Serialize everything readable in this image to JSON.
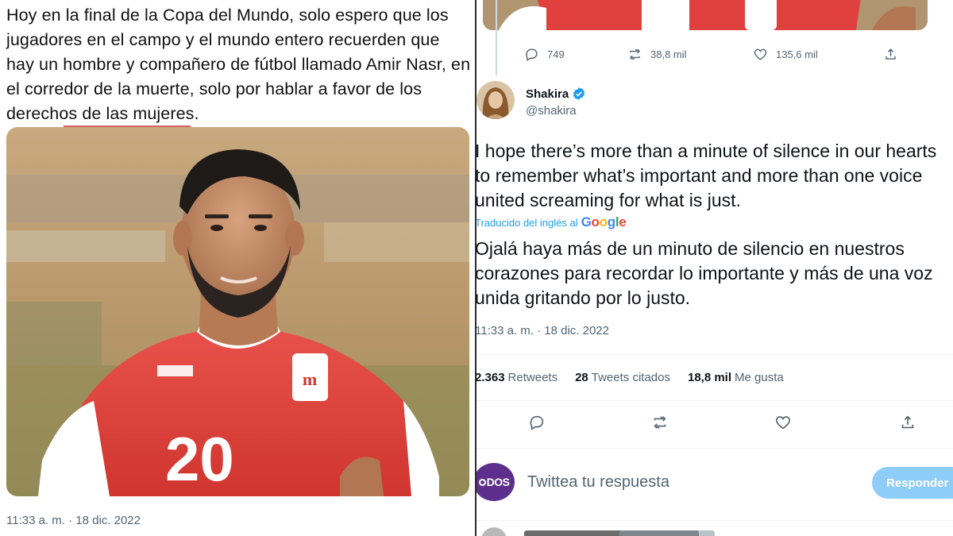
{
  "left": {
    "tweet_text": "Hoy en la final de la Copa del Mundo, solo espero que los jugadores en el campo y el mundo entero recuerden que hay un hombre y compañero de fútbol llamado Amir Nasr, en el corredor de la muerte, solo por hablar a favor de los derechos de las mujeres.",
    "shirt_number": "20",
    "timestamp": "11:33 a. m. · 18 dic. 2022"
  },
  "right": {
    "prev_tweet_actions": {
      "replies": "749",
      "retweets": "38,8 mil",
      "likes": "135,6 mil"
    },
    "author": {
      "name": "Shakira",
      "handle": "@shakira",
      "verified": true
    },
    "tweet_original": "I hope there’s more than a minute of silence in our hearts to remember what’s important and more than one voice united screaming for what is just.",
    "translated_label": "Traducido del inglés al",
    "translator_brand": "Google",
    "tweet_translation": "Ojalá haya más de un minuto de silencio en nuestros corazones para recordar lo importante y más de una voz unida gritando por lo justo.",
    "timestamp": "11:33 a. m. · 18 dic. 2022",
    "stats": {
      "retweets_count": "2.363",
      "retweets_label": "Retweets",
      "quotes_count": "28",
      "quotes_label": "Tweets citados",
      "likes_count": "18,8 mil",
      "likes_label": "Me gusta"
    },
    "reply": {
      "avatar_text": "DOS",
      "placeholder": "Twittea tu respuesta",
      "button_label": "Responder"
    }
  },
  "colors": {
    "accent": "#1d9bf0",
    "muted": "#536471",
    "reply_button": "#8ecdf8",
    "jersey_red": "#e0413e"
  }
}
